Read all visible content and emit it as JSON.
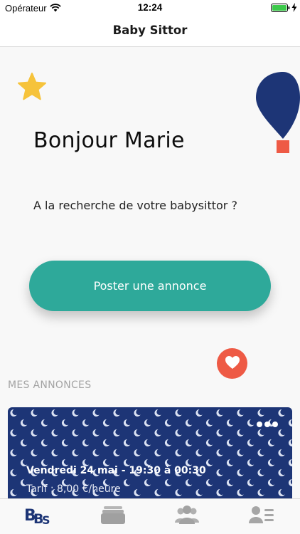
{
  "status_bar": {
    "carrier": "Opérateur",
    "time": "12:24"
  },
  "nav": {
    "title": "Baby Sittor"
  },
  "hero": {
    "greeting": "Bonjour Marie",
    "subtitle": "A la recherche de votre babysittor ?",
    "post_button_label": "Poster une annonce"
  },
  "section": {
    "title": "MES ANNONCES"
  },
  "announcement": {
    "date": "Vendredi 24 mai - 19:30 à 00:30",
    "rate": "Tarif : 8,00 €/heure"
  },
  "colors": {
    "accent": "#2ea99a",
    "card_background": "#1d3576",
    "favorite": "#ee5a45",
    "star": "#f6c33b",
    "balloon": "#1d3576"
  },
  "icons": {
    "status": [
      "wifi-icon",
      "battery-icon",
      "charging-icon"
    ],
    "hero": [
      "star-icon",
      "balloon-icon",
      "heart-icon"
    ],
    "card": [
      "moon-pattern",
      "more-icon"
    ],
    "tabs": [
      "home-logo-icon",
      "cards-icon",
      "community-icon",
      "profile-list-icon"
    ]
  }
}
